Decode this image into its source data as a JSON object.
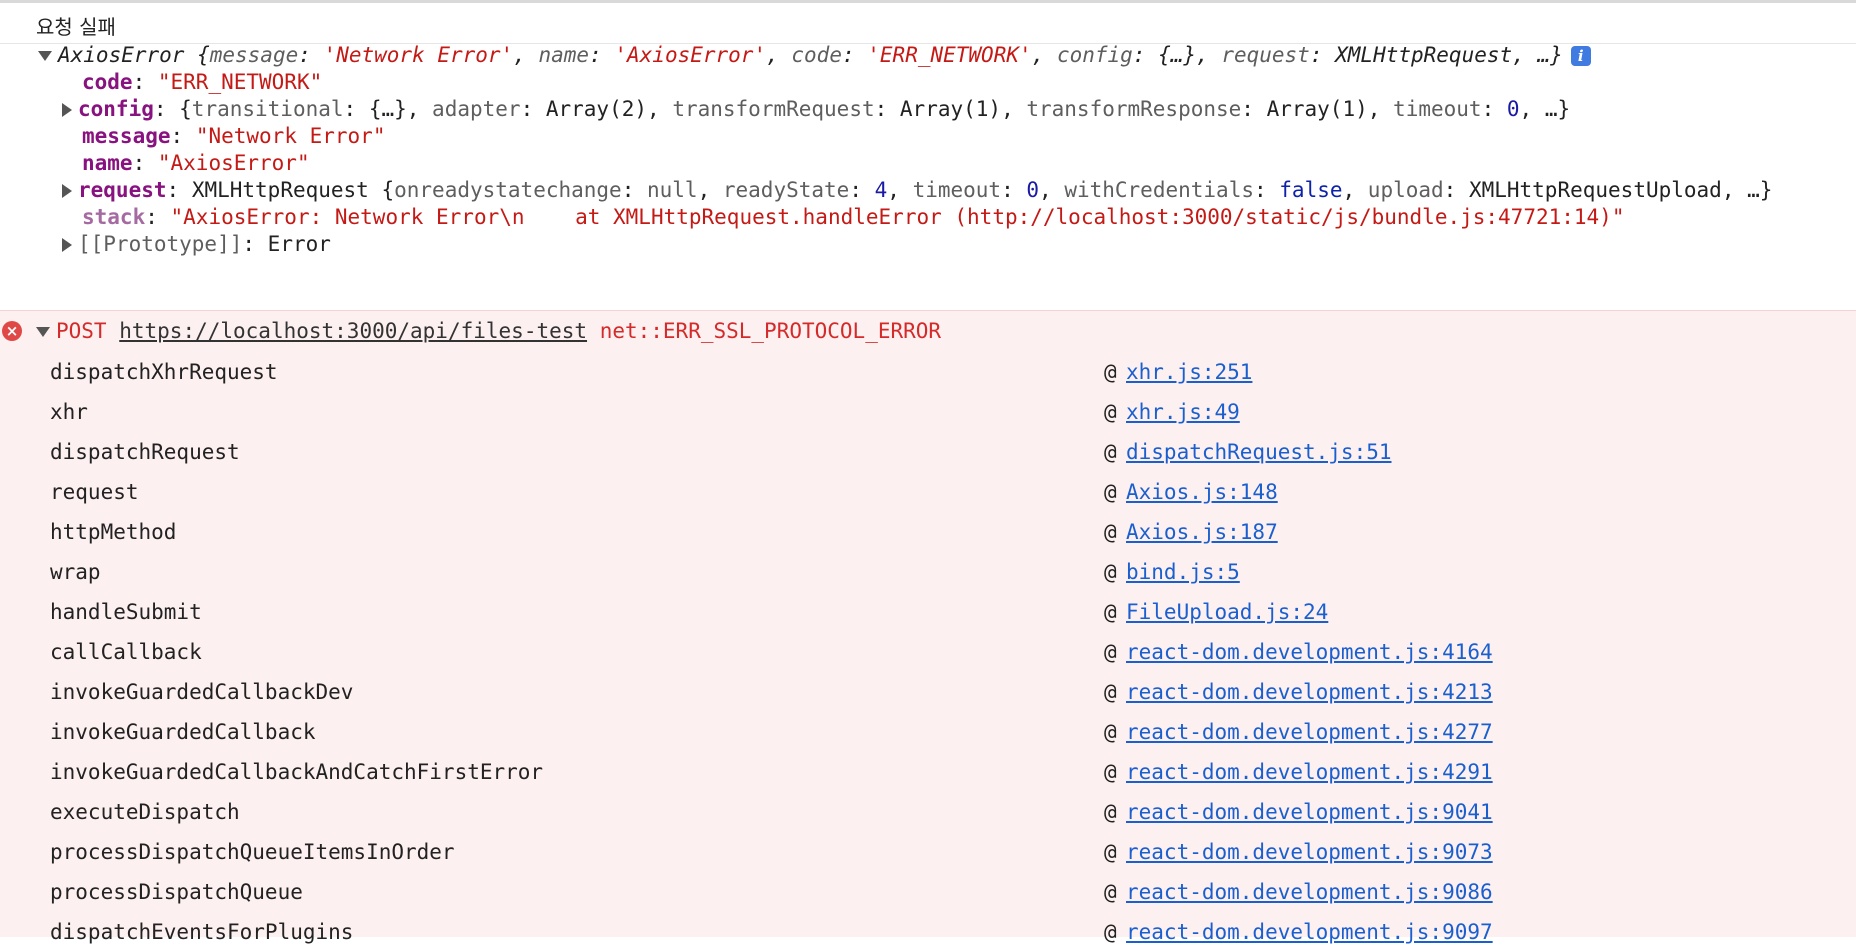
{
  "log_message": "요청 실패",
  "axios_error": {
    "summary": {
      "class_name": "AxiosError",
      "k_message": "message",
      "v_message": "'Network Error'",
      "k_name": "name",
      "v_name": "'AxiosError'",
      "k_code": "code",
      "v_code": "'ERR_NETWORK'",
      "k_config": "config",
      "v_config": "{…}",
      "k_request": "request",
      "v_request": "XMLHttpRequest",
      "ellipsis": "…}"
    },
    "code": {
      "key": "code",
      "value": "\"ERR_NETWORK\""
    },
    "config": {
      "key": "config",
      "k1": "transitional",
      "v1": "{…}",
      "k2": "adapter",
      "v2": "Array(2)",
      "k3": "transformRequest",
      "v3": "Array(1)",
      "k4": "transformResponse",
      "v4": "Array(1)",
      "k5": "timeout",
      "v5": "0",
      "ellipsis": "…}"
    },
    "message": {
      "key": "message",
      "value": "\"Network Error\""
    },
    "name": {
      "key": "name",
      "value": "\"AxiosError\""
    },
    "request": {
      "key": "request",
      "type": "XMLHttpRequest",
      "k1": "onreadystatechange",
      "v1": "null",
      "k2": "readyState",
      "v2": "4",
      "k3": "timeout",
      "v3": "0",
      "k4": "withCredentials",
      "v4": "false",
      "k5": "upload",
      "v5": "XMLHttpRequestUpload",
      "ellipsis": "…}"
    },
    "stack": {
      "key": "stack",
      "value": "\"AxiosError: Network Error\\n    at XMLHttpRequest.handleError (http://localhost:3000/static/js/bundle.js:47721:14)\""
    },
    "prototype": {
      "key": "[[Prototype]]",
      "value": "Error"
    }
  },
  "network_error": {
    "method": "POST",
    "url": "https://localhost:3000/api/files-test",
    "error": "net::ERR_SSL_PROTOCOL_ERROR",
    "icon": "error-circle-icon",
    "stack": [
      {
        "fn": "dispatchXhrRequest",
        "loc": "xhr.js:251"
      },
      {
        "fn": "xhr",
        "loc": "xhr.js:49"
      },
      {
        "fn": "dispatchRequest",
        "loc": "dispatchRequest.js:51"
      },
      {
        "fn": "request",
        "loc": "Axios.js:148"
      },
      {
        "fn": "httpMethod",
        "loc": "Axios.js:187"
      },
      {
        "fn": "wrap",
        "loc": "bind.js:5"
      },
      {
        "fn": "handleSubmit",
        "loc": "FileUpload.js:24"
      },
      {
        "fn": "callCallback",
        "loc": "react-dom.development.js:4164"
      },
      {
        "fn": "invokeGuardedCallbackDev",
        "loc": "react-dom.development.js:4213"
      },
      {
        "fn": "invokeGuardedCallback",
        "loc": "react-dom.development.js:4277"
      },
      {
        "fn": "invokeGuardedCallbackAndCatchFirstError",
        "loc": "react-dom.development.js:4291"
      },
      {
        "fn": "executeDispatch",
        "loc": "react-dom.development.js:9041"
      },
      {
        "fn": "processDispatchQueueItemsInOrder",
        "loc": "react-dom.development.js:9073"
      },
      {
        "fn": "processDispatchQueue",
        "loc": "react-dom.development.js:9086"
      },
      {
        "fn": "dispatchEventsForPlugins",
        "loc": "react-dom.development.js:9097"
      }
    ],
    "at_symbol": "@"
  },
  "colors": {
    "error_bg": "#fdf0f0",
    "error_text": "#d42a2a",
    "key": "#881280",
    "string": "#c41a16",
    "number": "#1a1aa6",
    "link": "#1a5fd0"
  }
}
